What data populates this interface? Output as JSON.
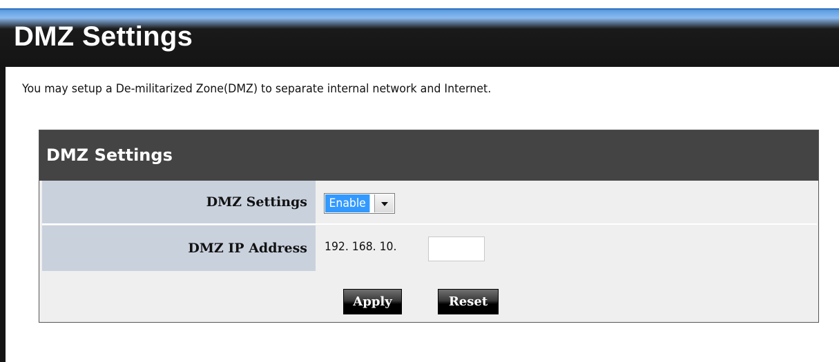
{
  "page": {
    "title": "DMZ Settings",
    "description": "You may setup a De-militarized Zone(DMZ) to separate internal network and Internet."
  },
  "panel": {
    "title": "DMZ Settings",
    "rows": {
      "dmz_settings": {
        "label": "DMZ Settings",
        "selected_value": "Enable"
      },
      "dmz_ip": {
        "label": "DMZ IP Address",
        "prefix": "192. 168. 10.",
        "value": ""
      }
    },
    "buttons": {
      "apply": "Apply",
      "reset": "Reset"
    }
  },
  "icons": {
    "select_arrow": "chevron-down-icon"
  },
  "colors": {
    "header_dark": "#141414",
    "header_blue": "#4a8fd8",
    "panel_head": "#444444",
    "label_bg": "#c9d1dd",
    "panel_bg": "#efefef",
    "select_highlight": "#3399ff"
  }
}
